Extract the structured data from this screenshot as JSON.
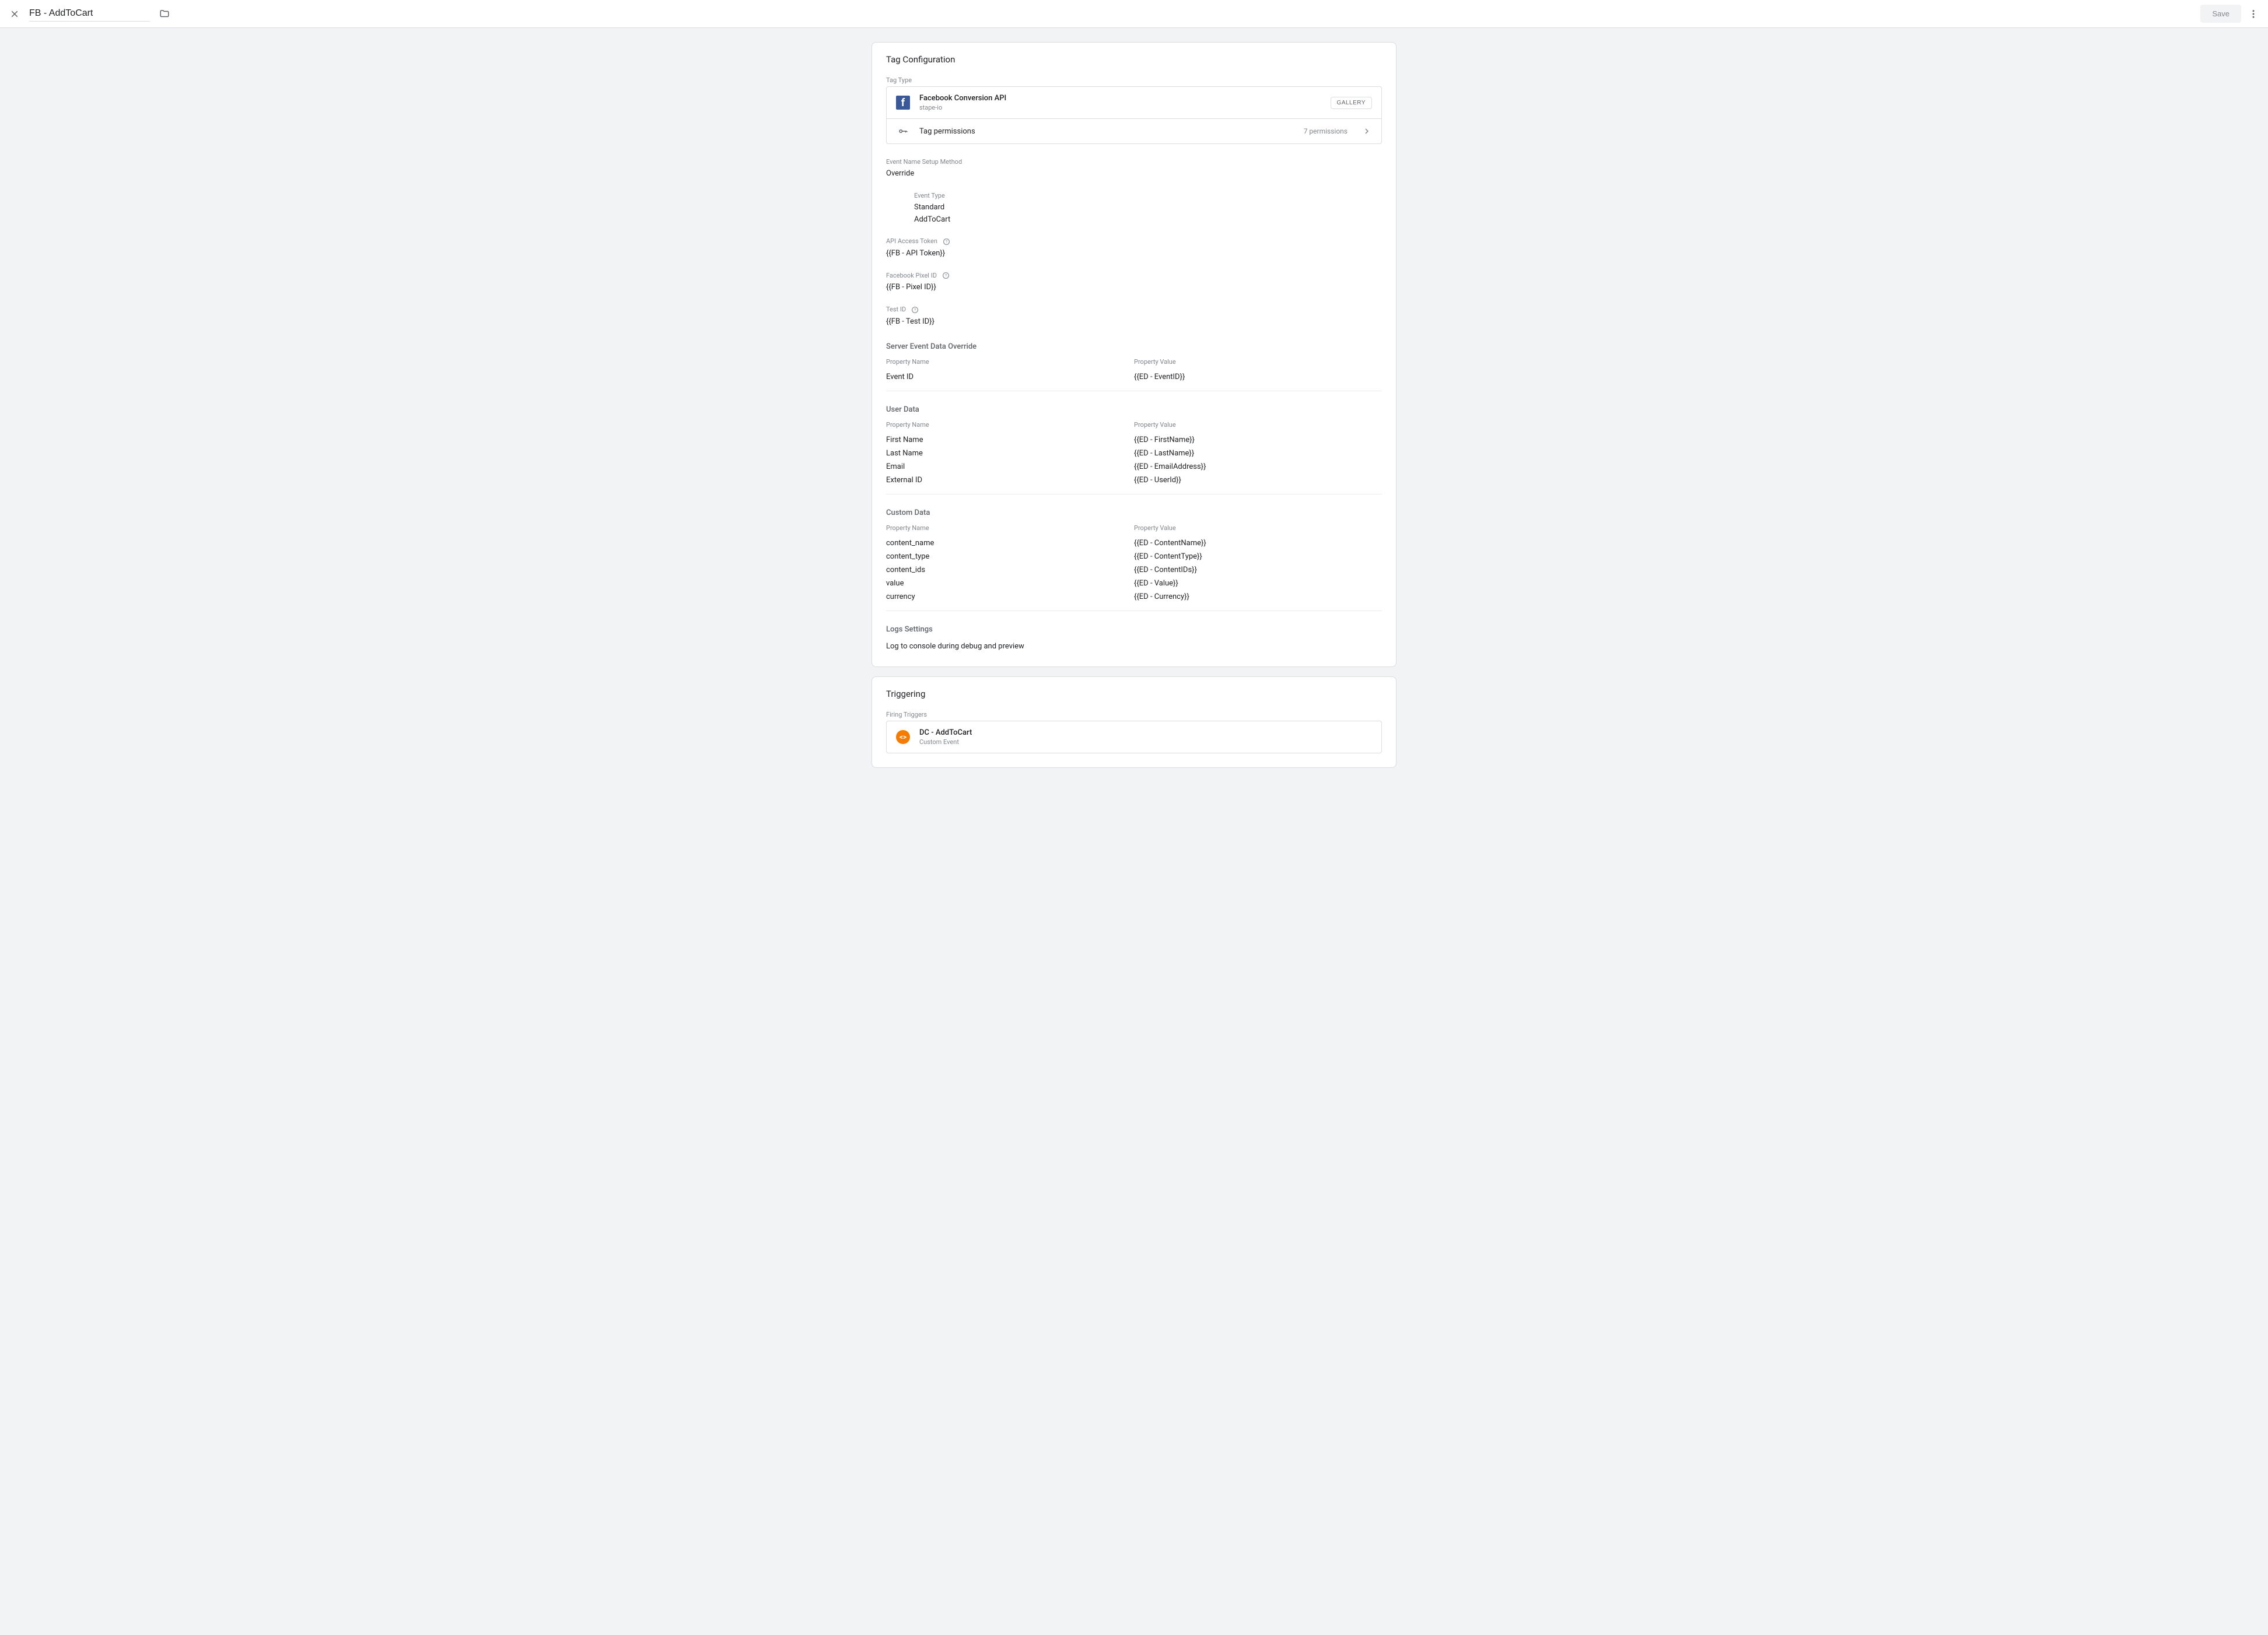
{
  "header": {
    "title": "FB - AddToCart",
    "save_label": "Save"
  },
  "tag_config": {
    "title": "Tag Configuration",
    "tag_type_label": "Tag Type",
    "type_name": "Facebook Conversion API",
    "type_sub": "stape-io",
    "gallery_label": "GALLERY",
    "permissions_label": "Tag permissions",
    "permissions_count": "7 permissions",
    "event_setup_label": "Event Name Setup Method",
    "event_setup_value": "Override",
    "event_type_label": "Event Type",
    "event_type_value": "Standard",
    "event_name_value": "AddToCart",
    "api_token_label": "API Access Token",
    "api_token_value": "{{FB - API Token}}",
    "pixel_label": "Facebook Pixel ID",
    "pixel_value": "{{FB - Pixel ID}}",
    "test_label": "Test ID",
    "test_value": "{{FB - Test ID}}",
    "server_override_title": "Server Event Data Override",
    "prop_name_header": "Property Name",
    "prop_value_header": "Property Value",
    "server_rows": [
      {
        "name": "Event ID",
        "value": "{{ED - EventID}}"
      }
    ],
    "user_data_title": "User Data",
    "user_rows": [
      {
        "name": "First Name",
        "value": "{{ED - FirstName}}"
      },
      {
        "name": "Last Name",
        "value": "{{ED - LastName}}"
      },
      {
        "name": "Email",
        "value": "{{ED - EmailAddress}}"
      },
      {
        "name": "External ID",
        "value": "{{ED - UserId}}"
      }
    ],
    "custom_data_title": "Custom Data",
    "custom_rows": [
      {
        "name": "content_name",
        "value": "{{ED - ContentName}}"
      },
      {
        "name": "content_type",
        "value": "{{ED - ContentType}}"
      },
      {
        "name": "content_ids",
        "value": "{{ED - ContentIDs}}"
      },
      {
        "name": "value",
        "value": "{{ED - Value}}"
      },
      {
        "name": "currency",
        "value": "{{ED - Currency}}"
      }
    ],
    "logs_title": "Logs Settings",
    "logs_value": "Log to console during debug and preview"
  },
  "triggering": {
    "title": "Triggering",
    "firing_label": "Firing Triggers",
    "trigger_name": "DC - AddToCart",
    "trigger_type": "Custom Event"
  }
}
